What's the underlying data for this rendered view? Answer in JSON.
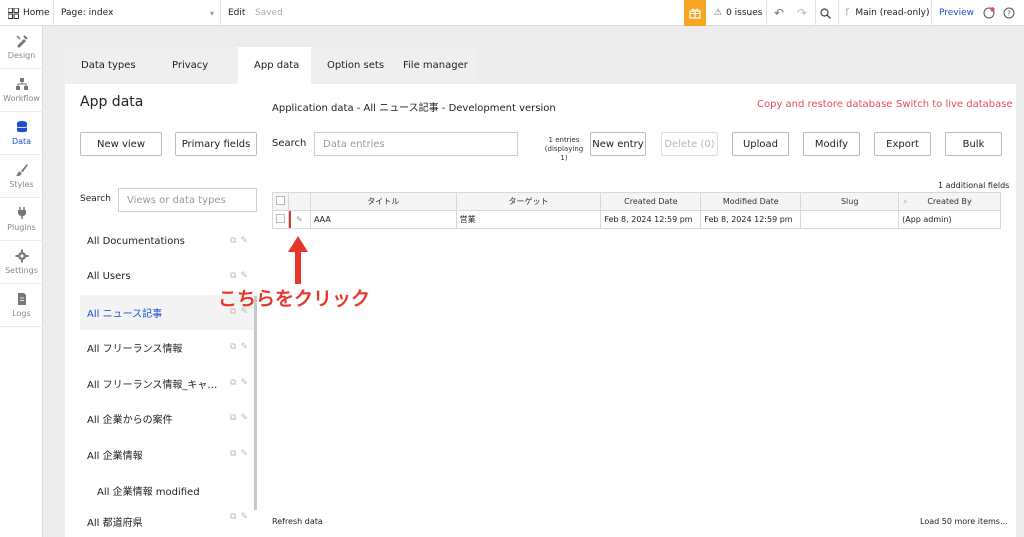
{
  "topbar": {
    "home": "Home",
    "page_label": "Page: index",
    "edit": "Edit",
    "saved": "Saved",
    "issues": "0 issues",
    "branch": "Main (read-only)",
    "preview": "Preview"
  },
  "rail": [
    {
      "label": "Design",
      "icon": "design-icon"
    },
    {
      "label": "Workflow",
      "icon": "workflow-icon"
    },
    {
      "label": "Data",
      "icon": "database-icon",
      "active": true
    },
    {
      "label": "Styles",
      "icon": "brush-icon"
    },
    {
      "label": "Plugins",
      "icon": "plug-icon"
    },
    {
      "label": "Settings",
      "icon": "gear-icon"
    },
    {
      "label": "Logs",
      "icon": "document-icon"
    }
  ],
  "tabs": [
    "Data types",
    "Privacy",
    "App data",
    "Option sets",
    "File manager"
  ],
  "app_data": {
    "title": "App data",
    "new_view": "New view",
    "primary_fields": "Primary fields",
    "search_label": "Search",
    "search_placeholder": "Views or data types",
    "items": [
      "All Documentations",
      "All Users",
      "All ニュース記事",
      "All フリーランス情報",
      "All フリーランス情報_キャ…",
      "All 企業からの案件",
      "All 企業情報",
      "All 企業情報 modified",
      "All 都道府県"
    ]
  },
  "main": {
    "heading": "Application data - All ニュース記事 - Development version",
    "copy_restore": "Copy and restore database",
    "switch_live": "Switch to live database",
    "search_label": "Search",
    "search_placeholder": "Data entries",
    "entries_count_line1": "1 entries",
    "entries_count_line2": "(displaying",
    "entries_count_line3": "1)",
    "new_entry": "New entry",
    "delete": "Delete (0)",
    "upload": "Upload",
    "modify": "Modify",
    "export": "Export",
    "bulk": "Bulk",
    "additional_fields": "1 additional fields",
    "columns": [
      "タイトル",
      "ターゲット",
      "Created Date",
      "Modified Date",
      "Slug",
      "Created By"
    ],
    "rows": [
      [
        "AAA",
        "営業",
        "Feb 8, 2024 12:59 pm",
        "Feb 8, 2024 12:59 pm",
        "",
        "(App admin)"
      ]
    ],
    "refresh": "Refresh data",
    "load_more": "Load 50 more items..."
  },
  "annotation": "こちらをクリック",
  "colors": {
    "accent": "#1f4fd1",
    "link_red": "#e84a5f",
    "annotation_red": "#e5372a",
    "gift_orange": "#f5a623"
  }
}
